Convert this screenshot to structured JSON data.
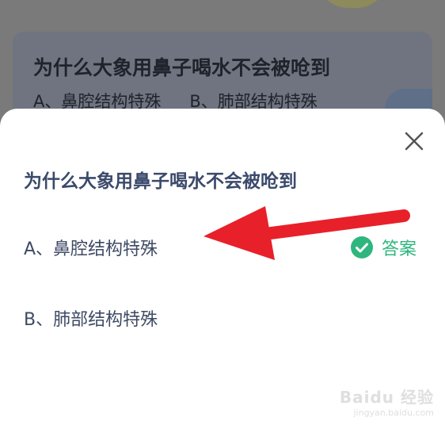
{
  "background": {
    "question": "为什么大象用鼻子喝水不会被呛到",
    "options": [
      "A、鼻腔结构特殊",
      "B、肺部结构特殊"
    ]
  },
  "dialog": {
    "close_icon": "close-icon",
    "question": "为什么大象用鼻子喝水不会被呛到",
    "options": [
      {
        "label": "A、鼻腔结构特殊",
        "is_answer": true
      },
      {
        "label": "B、肺部结构特殊",
        "is_answer": false
      }
    ],
    "answer_label": "答案",
    "answer_icon": "check-circle-icon",
    "accent_color": "#2fb67e",
    "title_color": "#3b4a6b"
  },
  "annotation": {
    "arrow_color": "#e8202a",
    "arrow_icon": "arrow-left-icon"
  },
  "watermark": {
    "brand": "Baidu 经验",
    "url": "jingyan.baidu.com"
  }
}
